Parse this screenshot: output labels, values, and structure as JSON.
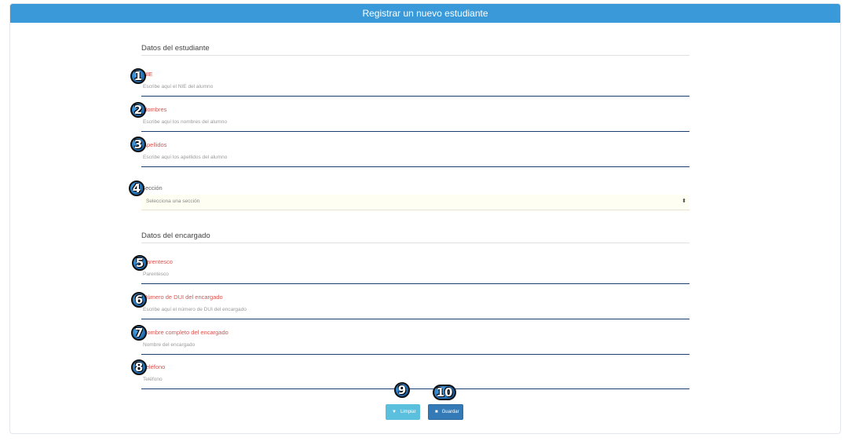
{
  "header": {
    "title": "Registrar un nuevo estudiante"
  },
  "sections": {
    "student": "Datos del estudiante",
    "guardian": "Datos del encargado"
  },
  "fields": {
    "nie": {
      "label": "NIE",
      "placeholder": "Escribe aquí el NIE del alumno"
    },
    "nombres": {
      "label": "Nombres",
      "placeholder": "Escribe aquí los nombres del alumno"
    },
    "apellidos": {
      "label": "Apellidos",
      "placeholder": "Escribe aquí los apellidos del alumno"
    },
    "seccion": {
      "label": "Sección",
      "value": "Selecciona una sección"
    },
    "parentesco": {
      "label": "Parentesco",
      "placeholder": "Parentesco"
    },
    "dui": {
      "label": "Número de DUI del encargado",
      "placeholder": "Escribe aquí el número de DUI del encargado"
    },
    "nombre_encargado": {
      "label": "Nombre completo del encargado",
      "placeholder": "Nombre del encargado"
    },
    "telefono": {
      "label": "Teléfono",
      "placeholder": "Teléfono"
    }
  },
  "buttons": {
    "clear": {
      "label": "Limpiar",
      "icon": "broom-icon"
    },
    "save": {
      "label": "Guardar",
      "icon": "floppy-disk-icon"
    }
  },
  "badges": [
    "1",
    "2",
    "3",
    "4",
    "5",
    "6",
    "7",
    "8",
    "9",
    "10"
  ],
  "colors": {
    "header": "#3a9ad9",
    "label": "#d9534f",
    "underline": "#1c3d72",
    "clear": "#5bc0de",
    "save": "#337ab7"
  }
}
